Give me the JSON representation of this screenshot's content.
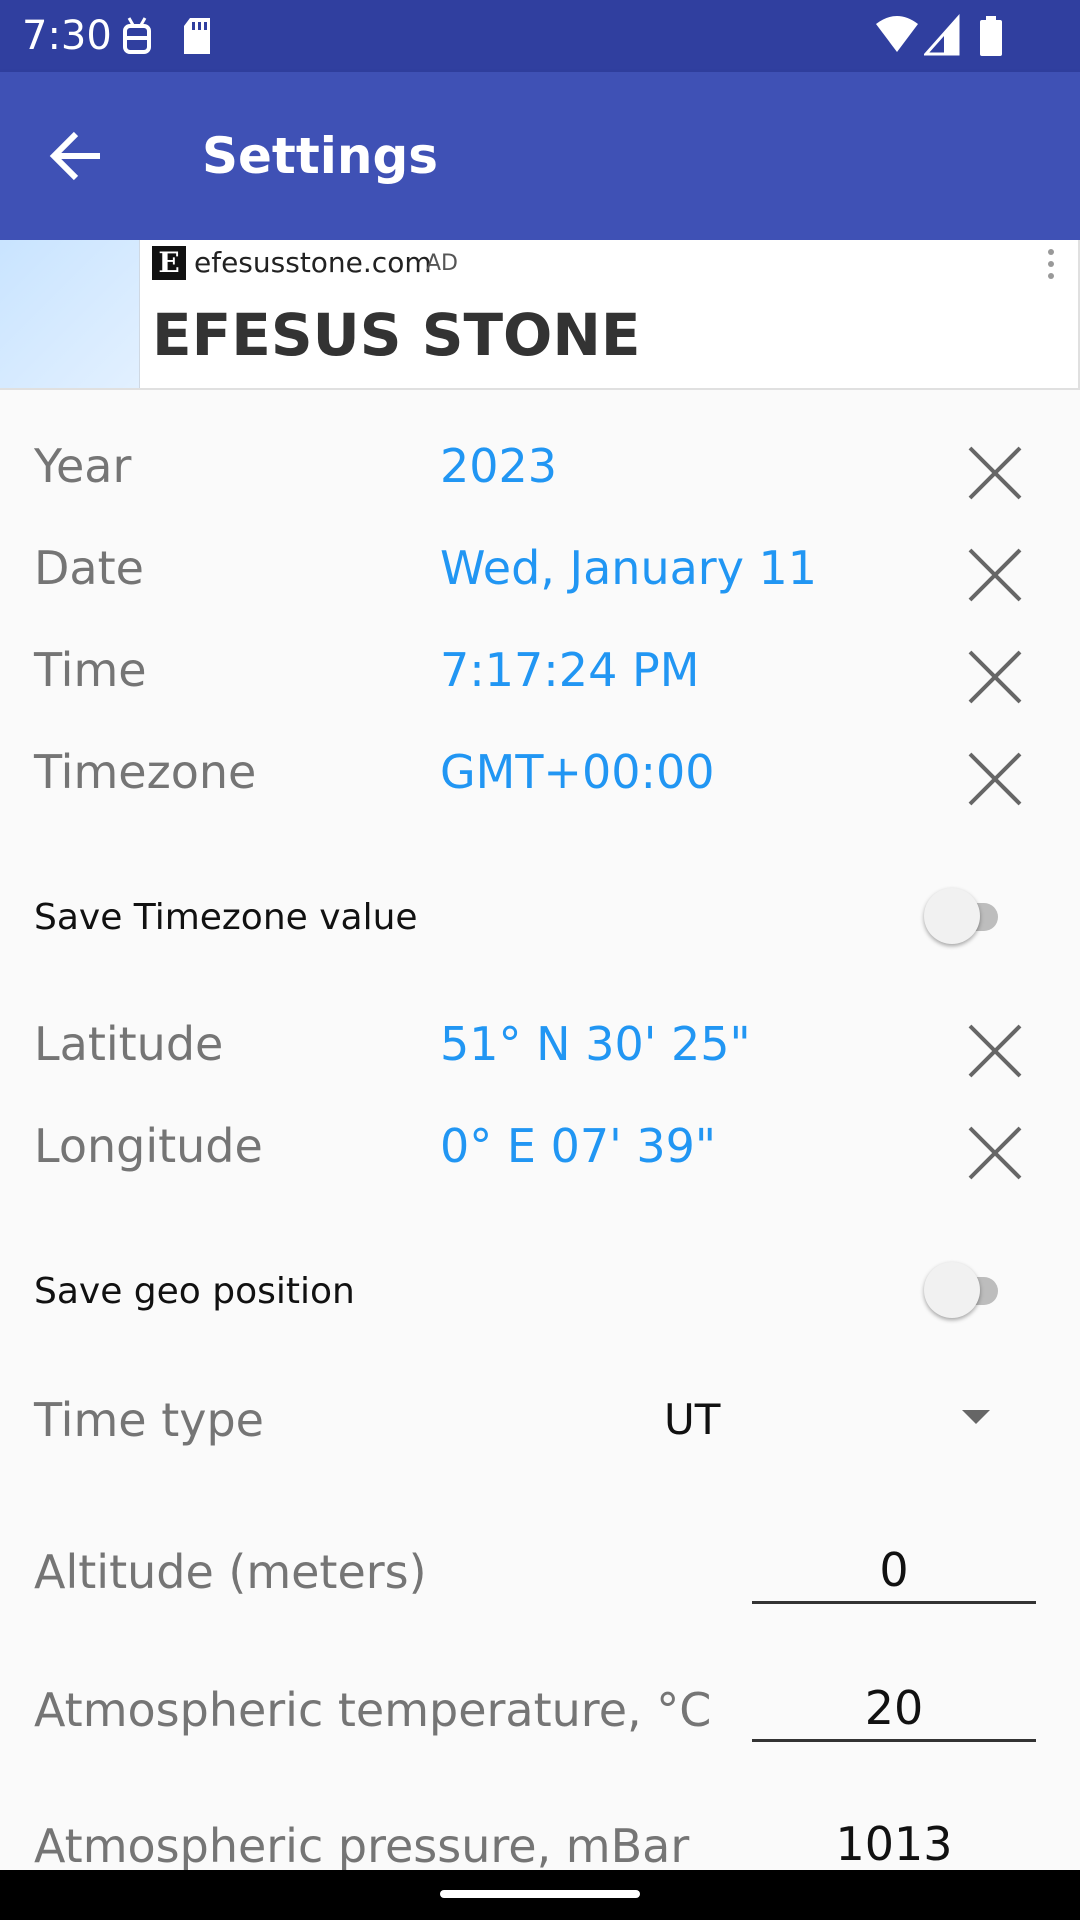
{
  "status_bar": {
    "time": "7:30",
    "icons": [
      "android-debug-icon",
      "sd-card-icon",
      "wifi-icon",
      "cell-signal-icon",
      "battery-icon"
    ]
  },
  "app_bar": {
    "title": "Settings",
    "back_icon": "arrow-back-icon",
    "background": "#3f51b5",
    "status_background": "#303f9f"
  },
  "ad": {
    "logo_letter": "E",
    "domain": "efesusstone.com",
    "label": "AD",
    "headline": "EFESUS STONE"
  },
  "settings": {
    "year": {
      "label": "Year",
      "value": "2023"
    },
    "date": {
      "label": "Date",
      "value": "Wed, January 11"
    },
    "time": {
      "label": "Time",
      "value": "7:17:24 PM"
    },
    "timezone": {
      "label": "Timezone",
      "value": "GMT+00:00"
    },
    "save_timezone": {
      "label": "Save Timezone value",
      "on": false
    },
    "latitude": {
      "label": "Latitude",
      "value": "51° N 30' 25\""
    },
    "longitude": {
      "label": "Longitude",
      "value": "0° E 07' 39\""
    },
    "save_geo": {
      "label": "Save geo position",
      "on": false
    },
    "time_type": {
      "label": "Time type",
      "value": "UT"
    },
    "altitude": {
      "label": "Altitude (meters)",
      "value": "0"
    },
    "temperature": {
      "label": "Atmospheric temperature, °C",
      "value": "20"
    },
    "pressure": {
      "label": "Atmospheric pressure, mBar",
      "value": "1013"
    }
  },
  "colors": {
    "value_text": "#2196f3",
    "label_text": "#757575"
  }
}
